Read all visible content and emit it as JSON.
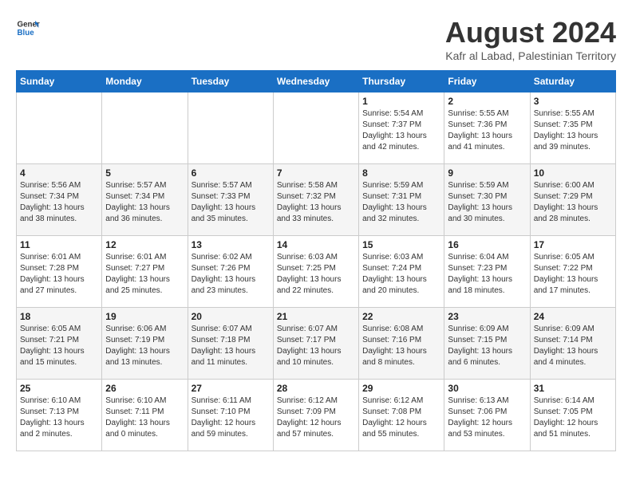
{
  "logo": {
    "line1": "General",
    "line2": "Blue"
  },
  "title": "August 2024",
  "location": "Kafr al Labad, Palestinian Territory",
  "days_header": [
    "Sunday",
    "Monday",
    "Tuesday",
    "Wednesday",
    "Thursday",
    "Friday",
    "Saturday"
  ],
  "weeks": [
    [
      {
        "day": "",
        "info": ""
      },
      {
        "day": "",
        "info": ""
      },
      {
        "day": "",
        "info": ""
      },
      {
        "day": "",
        "info": ""
      },
      {
        "day": "1",
        "info": "Sunrise: 5:54 AM\nSunset: 7:37 PM\nDaylight: 13 hours\nand 42 minutes."
      },
      {
        "day": "2",
        "info": "Sunrise: 5:55 AM\nSunset: 7:36 PM\nDaylight: 13 hours\nand 41 minutes."
      },
      {
        "day": "3",
        "info": "Sunrise: 5:55 AM\nSunset: 7:35 PM\nDaylight: 13 hours\nand 39 minutes."
      }
    ],
    [
      {
        "day": "4",
        "info": "Sunrise: 5:56 AM\nSunset: 7:34 PM\nDaylight: 13 hours\nand 38 minutes."
      },
      {
        "day": "5",
        "info": "Sunrise: 5:57 AM\nSunset: 7:34 PM\nDaylight: 13 hours\nand 36 minutes."
      },
      {
        "day": "6",
        "info": "Sunrise: 5:57 AM\nSunset: 7:33 PM\nDaylight: 13 hours\nand 35 minutes."
      },
      {
        "day": "7",
        "info": "Sunrise: 5:58 AM\nSunset: 7:32 PM\nDaylight: 13 hours\nand 33 minutes."
      },
      {
        "day": "8",
        "info": "Sunrise: 5:59 AM\nSunset: 7:31 PM\nDaylight: 13 hours\nand 32 minutes."
      },
      {
        "day": "9",
        "info": "Sunrise: 5:59 AM\nSunset: 7:30 PM\nDaylight: 13 hours\nand 30 minutes."
      },
      {
        "day": "10",
        "info": "Sunrise: 6:00 AM\nSunset: 7:29 PM\nDaylight: 13 hours\nand 28 minutes."
      }
    ],
    [
      {
        "day": "11",
        "info": "Sunrise: 6:01 AM\nSunset: 7:28 PM\nDaylight: 13 hours\nand 27 minutes."
      },
      {
        "day": "12",
        "info": "Sunrise: 6:01 AM\nSunset: 7:27 PM\nDaylight: 13 hours\nand 25 minutes."
      },
      {
        "day": "13",
        "info": "Sunrise: 6:02 AM\nSunset: 7:26 PM\nDaylight: 13 hours\nand 23 minutes."
      },
      {
        "day": "14",
        "info": "Sunrise: 6:03 AM\nSunset: 7:25 PM\nDaylight: 13 hours\nand 22 minutes."
      },
      {
        "day": "15",
        "info": "Sunrise: 6:03 AM\nSunset: 7:24 PM\nDaylight: 13 hours\nand 20 minutes."
      },
      {
        "day": "16",
        "info": "Sunrise: 6:04 AM\nSunset: 7:23 PM\nDaylight: 13 hours\nand 18 minutes."
      },
      {
        "day": "17",
        "info": "Sunrise: 6:05 AM\nSunset: 7:22 PM\nDaylight: 13 hours\nand 17 minutes."
      }
    ],
    [
      {
        "day": "18",
        "info": "Sunrise: 6:05 AM\nSunset: 7:21 PM\nDaylight: 13 hours\nand 15 minutes."
      },
      {
        "day": "19",
        "info": "Sunrise: 6:06 AM\nSunset: 7:19 PM\nDaylight: 13 hours\nand 13 minutes."
      },
      {
        "day": "20",
        "info": "Sunrise: 6:07 AM\nSunset: 7:18 PM\nDaylight: 13 hours\nand 11 minutes."
      },
      {
        "day": "21",
        "info": "Sunrise: 6:07 AM\nSunset: 7:17 PM\nDaylight: 13 hours\nand 10 minutes."
      },
      {
        "day": "22",
        "info": "Sunrise: 6:08 AM\nSunset: 7:16 PM\nDaylight: 13 hours\nand 8 minutes."
      },
      {
        "day": "23",
        "info": "Sunrise: 6:09 AM\nSunset: 7:15 PM\nDaylight: 13 hours\nand 6 minutes."
      },
      {
        "day": "24",
        "info": "Sunrise: 6:09 AM\nSunset: 7:14 PM\nDaylight: 13 hours\nand 4 minutes."
      }
    ],
    [
      {
        "day": "25",
        "info": "Sunrise: 6:10 AM\nSunset: 7:13 PM\nDaylight: 13 hours\nand 2 minutes."
      },
      {
        "day": "26",
        "info": "Sunrise: 6:10 AM\nSunset: 7:11 PM\nDaylight: 13 hours\nand 0 minutes."
      },
      {
        "day": "27",
        "info": "Sunrise: 6:11 AM\nSunset: 7:10 PM\nDaylight: 12 hours\nand 59 minutes."
      },
      {
        "day": "28",
        "info": "Sunrise: 6:12 AM\nSunset: 7:09 PM\nDaylight: 12 hours\nand 57 minutes."
      },
      {
        "day": "29",
        "info": "Sunrise: 6:12 AM\nSunset: 7:08 PM\nDaylight: 12 hours\nand 55 minutes."
      },
      {
        "day": "30",
        "info": "Sunrise: 6:13 AM\nSunset: 7:06 PM\nDaylight: 12 hours\nand 53 minutes."
      },
      {
        "day": "31",
        "info": "Sunrise: 6:14 AM\nSunset: 7:05 PM\nDaylight: 12 hours\nand 51 minutes."
      }
    ]
  ]
}
